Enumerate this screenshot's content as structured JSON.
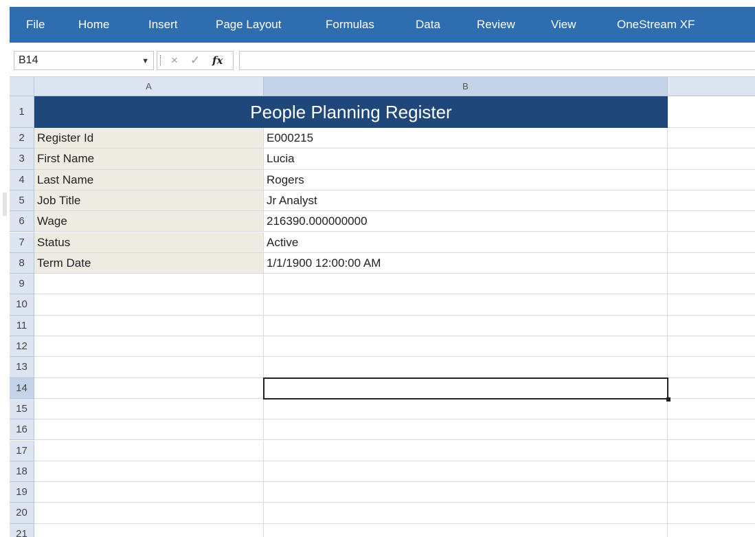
{
  "ribbon": {
    "tabs": [
      "File",
      "Home",
      "Insert",
      "Page Layout",
      "Formulas",
      "Data",
      "Review",
      "View",
      "OneStream XF"
    ]
  },
  "formula_bar": {
    "name_box": "B14",
    "cancel_icon": "×",
    "confirm_icon": "✓",
    "fx_label": "fx",
    "formula_value": ""
  },
  "sheet": {
    "columns": [
      "A",
      "B"
    ],
    "selected_column": "B",
    "selected_row": 14,
    "title": "People Planning Register",
    "rows": [
      {
        "label": "Register Id",
        "value": "E000215"
      },
      {
        "label": "First Name",
        "value": "Lucia"
      },
      {
        "label": "Last Name",
        "value": "Rogers"
      },
      {
        "label": "Job Title",
        "value": "Jr Analyst"
      },
      {
        "label": "Wage",
        "value": "216390.000000000"
      },
      {
        "label": "Status",
        "value": "Active"
      },
      {
        "label": "Term Date",
        "value": "1/1/1900 12:00:00 AM"
      }
    ],
    "row_numbers": [
      "1",
      "2",
      "3",
      "4",
      "5",
      "6",
      "7",
      "8",
      "9",
      "10",
      "11",
      "12",
      "13",
      "14",
      "15",
      "16",
      "17",
      "18",
      "19",
      "20",
      "21"
    ]
  },
  "colors": {
    "ribbon": "#2e6db0",
    "title_fill": "#1f477a",
    "label_fill": "#eeece2",
    "header_fill": "#dde5f2"
  }
}
